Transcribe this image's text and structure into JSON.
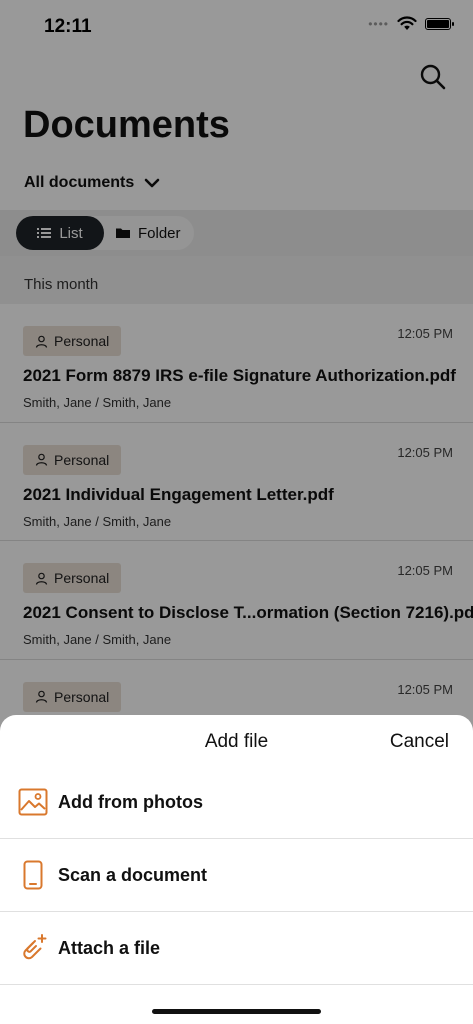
{
  "status_bar": {
    "time": "12:11"
  },
  "header": {
    "title": "Documents",
    "filter_label": "All documents"
  },
  "view_toggle": {
    "list_label": "List",
    "folder_label": "Folder"
  },
  "section": {
    "label": "This month"
  },
  "documents": [
    {
      "tag": "Personal",
      "time": "12:05 PM",
      "name": "2021 Form 8879 IRS e-file Signature Authorization.pdf",
      "owner": "Smith, Jane / Smith, Jane"
    },
    {
      "tag": "Personal",
      "time": "12:05 PM",
      "name": "2021 Individual Engagement Letter.pdf",
      "owner": "Smith, Jane / Smith, Jane"
    },
    {
      "tag": "Personal",
      "time": "12:05 PM",
      "name": "2021 Consent to Disclose T...ormation (Section 7216).pdf",
      "owner": "Smith, Jane / Smith, Jane"
    },
    {
      "tag": "Personal",
      "time": "12:05 PM",
      "name": "",
      "owner": ""
    }
  ],
  "sheet": {
    "title": "Add file",
    "cancel_label": "Cancel",
    "options": [
      {
        "label": "Add from photos",
        "icon": "image-icon"
      },
      {
        "label": "Scan a document",
        "icon": "phone-icon"
      },
      {
        "label": "Attach a file",
        "icon": "paperclip-icon"
      }
    ]
  },
  "colors": {
    "accent": "#d9782d",
    "tag_background": "#eadfd6",
    "toggle_active": "#1f2328",
    "overlay": "rgba(0,0,0,0.4)"
  }
}
